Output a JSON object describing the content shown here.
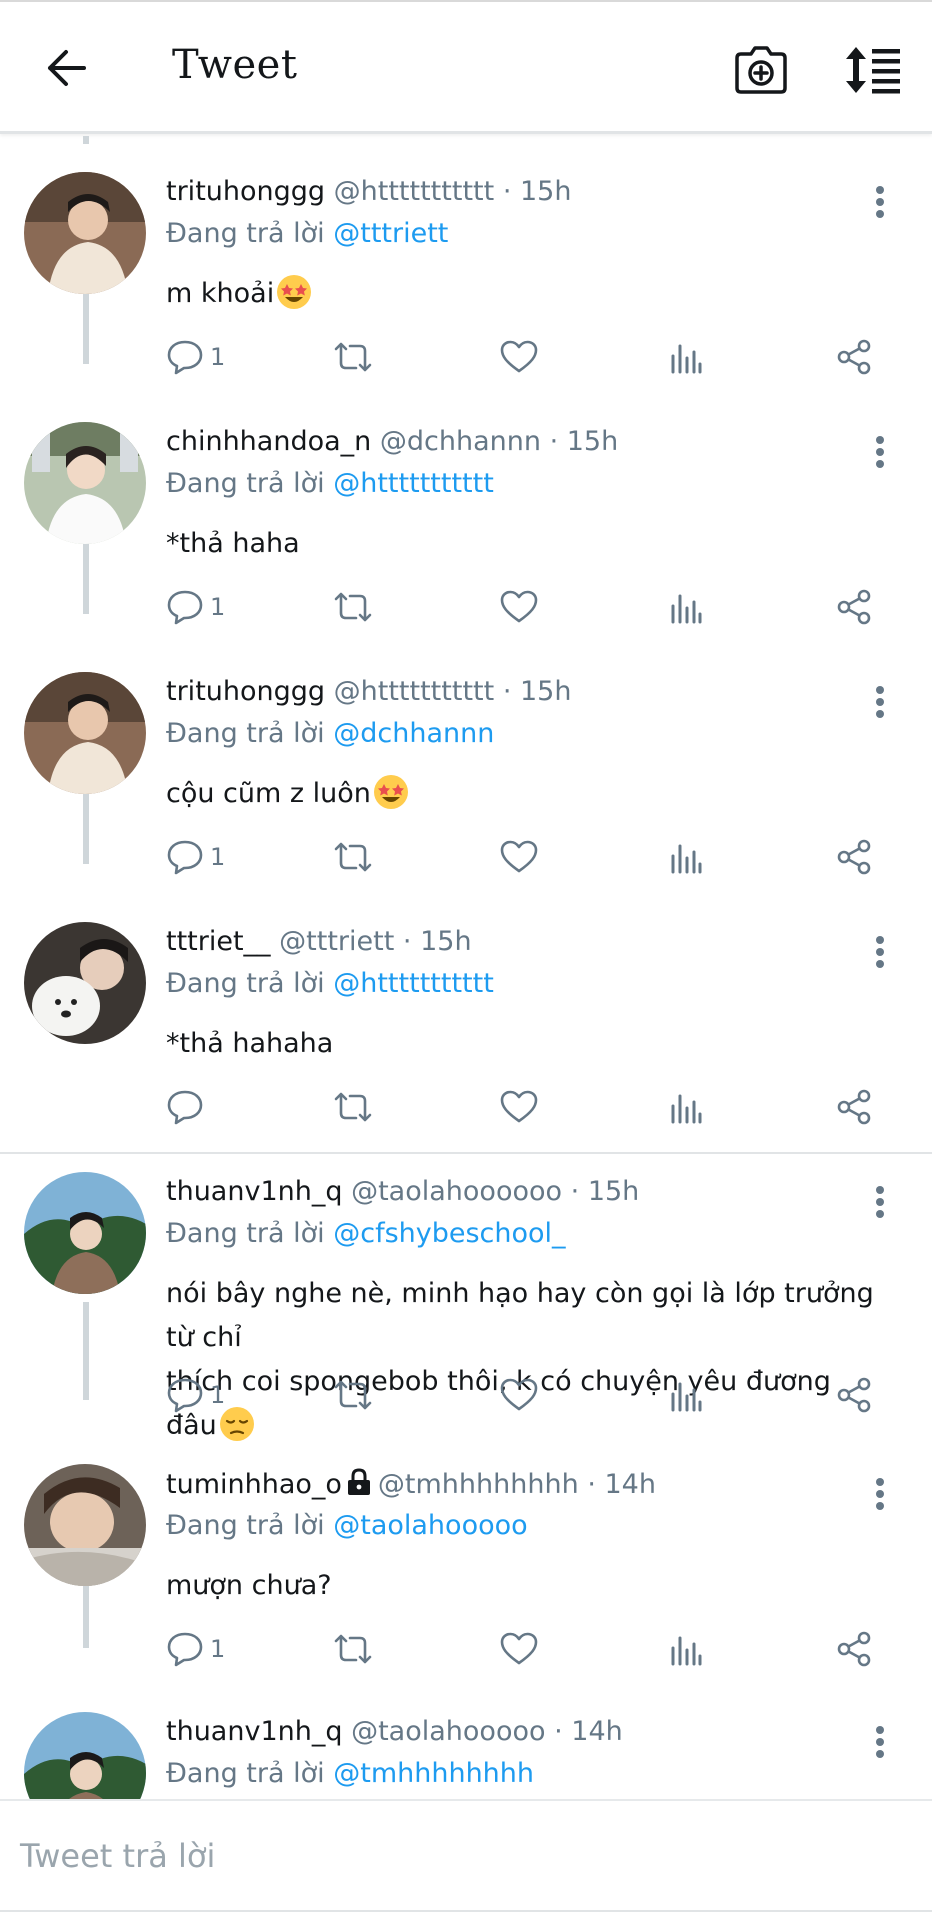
{
  "header": {
    "title": "Tweet"
  },
  "icons": {
    "back": "arrow-left-icon",
    "camera": "camera-plus-icon",
    "sort": "sort-icon",
    "reply": "comment-icon",
    "retweet": "retweet-icon",
    "like": "heart-icon",
    "views": "bar-chart-icon",
    "share": "share-icon",
    "more": "vertical-dots-icon"
  },
  "colors": {
    "mention": "#1d9bf0",
    "secondary": "#657786",
    "text": "#14171a"
  },
  "tweets": [
    {
      "name": "trituhonggg",
      "handle": "@httttttttttt",
      "dot": "·",
      "time": "15h",
      "reply_prefix": "Đang trả lời",
      "reply_to": "@tttriett",
      "text": "m khoải",
      "emoji": "star-struck-emoji",
      "reply_count": "1"
    },
    {
      "name": "chinhhandoa_n",
      "handle": "@dchhannn",
      "dot": "·",
      "time": "15h",
      "reply_prefix": "Đang trả lời",
      "reply_to": "@httttttttttt",
      "text": "*thả haha",
      "reply_count": "1"
    },
    {
      "name": "trituhonggg",
      "handle": "@httttttttttt",
      "dot": "·",
      "time": "15h",
      "reply_prefix": "Đang trả lời",
      "reply_to": "@dchhannn",
      "text": "cộu cũm z luôn",
      "emoji": "star-struck-emoji",
      "reply_count": "1"
    },
    {
      "name": "tttriet__",
      "handle": "@tttriett",
      "dot": "·",
      "time": "15h",
      "reply_prefix": "Đang trả lời",
      "reply_to": "@httttttttttt",
      "text": "*thả hahaha",
      "reply_count": ""
    },
    {
      "name": "thuanv1nh_q",
      "handle": "@taolahoooooo",
      "dot": "·",
      "time": "15h",
      "reply_prefix": "Đang trả lời",
      "reply_to": "@cfshybeschool_",
      "text_line1": "nói bây nghe nè, minh hạo hay còn gọi là lớp trưởng từ chỉ",
      "text_line2": "thích coi spongebob thôi, k có chuyện yêu đương đâu",
      "emoji": "pensive-emoji",
      "reply_count": "1"
    },
    {
      "name": "tuminhhao_o",
      "handle": "@tmhhhhhhhh",
      "dot": "·",
      "time": "14h",
      "reply_prefix": "Đang trả lời",
      "reply_to": "@taolahooooo",
      "text": "mượn chưa?",
      "protected_icon": "lock-icon",
      "reply_count": "1"
    },
    {
      "name": "thuanv1nh_q",
      "handle": "@taolahooooo",
      "dot": "·",
      "time": "14h",
      "reply_prefix": "Đang trả lời",
      "reply_to": "@tmhhhhhhhh"
    }
  ],
  "composer": {
    "placeholder": "Tweet trả lời"
  }
}
